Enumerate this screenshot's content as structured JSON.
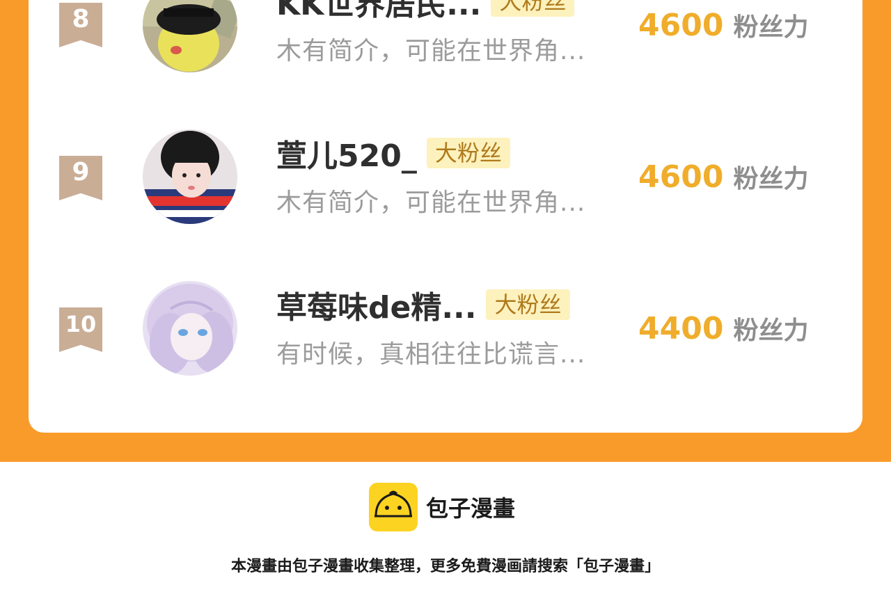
{
  "leaderboard": {
    "entries": [
      {
        "rank": "8",
        "name": "KK世界居民...",
        "badge": "大粉丝",
        "bio": "木有简介，可能在世界角...",
        "score": "4600",
        "score_unit": "粉丝力",
        "avatar": "pikachu-sunglasses-avatar"
      },
      {
        "rank": "9",
        "name": "萱儿520_",
        "badge": "大粉丝",
        "bio": "木有简介，可能在世界角...",
        "score": "4600",
        "score_unit": "粉丝力",
        "avatar": "girl-portrait-avatar"
      },
      {
        "rank": "10",
        "name": "草莓味de精...",
        "badge": "大粉丝",
        "bio": "有时候，真相往往比谎言...",
        "score": "4400",
        "score_unit": "粉丝力",
        "avatar": "anime-girl-avatar"
      }
    ]
  },
  "footer": {
    "brand": "包子漫畫",
    "note": "本漫畫由包子漫畫收集整理，更多免費漫画請搜索「包子漫畫」",
    "logo_icon": "bun-mascot-icon"
  },
  "colors": {
    "accent_orange": "#f99b2a",
    "score_gold": "#f0ad2b",
    "badge_bg": "#fdf2bd",
    "rank_tag": "#c9ad95",
    "logo_yellow": "#fcd321"
  }
}
